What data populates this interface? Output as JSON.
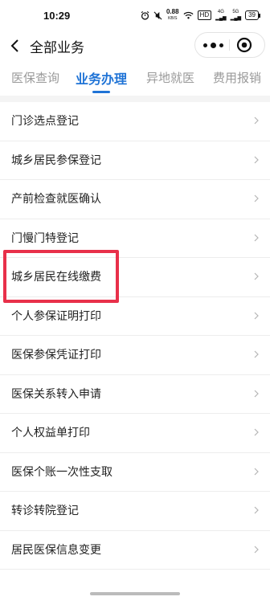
{
  "status_bar": {
    "time": "10:29",
    "speed": "0.88",
    "speed_unit": "KB/S",
    "hd": "HD",
    "signal_1": "4G",
    "signal_2": "5G",
    "battery": "39"
  },
  "header": {
    "title": "全部业务",
    "back_icon": "chevron-left-icon",
    "more_icon": "more-dots-icon",
    "close_icon": "target-circle-icon"
  },
  "tabs": [
    {
      "label": "医保查询",
      "active": false
    },
    {
      "label": "业务办理",
      "active": true
    },
    {
      "label": "异地就医",
      "active": false
    },
    {
      "label": "费用报销",
      "active": false
    }
  ],
  "list": [
    {
      "label": "门诊选点登记"
    },
    {
      "label": "城乡居民参保登记"
    },
    {
      "label": "产前检查就医确认"
    },
    {
      "label": "门慢门特登记"
    },
    {
      "label": "城乡居民在线缴费",
      "highlighted": true
    },
    {
      "label": "个人参保证明打印"
    },
    {
      "label": "医保参保凭证打印"
    },
    {
      "label": "医保关系转入申请"
    },
    {
      "label": "个人权益单打印"
    },
    {
      "label": "医保个账一次性支取"
    },
    {
      "label": "转诊转院登记"
    },
    {
      "label": "居民医保信息变更"
    }
  ],
  "colors": {
    "accent": "#1f73d6",
    "highlight": "#e8304a"
  }
}
